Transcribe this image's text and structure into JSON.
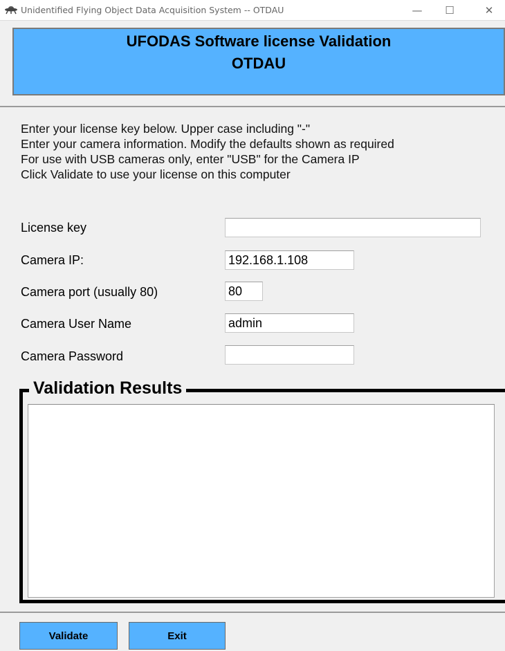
{
  "window": {
    "title": "Unidentified Flying Object Data Acquisition System -- OTDAU",
    "minimize_glyph": "—",
    "maximize_glyph": "☐",
    "close_glyph": "✕",
    "app_icon": "ufo-icon"
  },
  "banner": {
    "line1": "UFODAS Software license Validation",
    "line2": "OTDAU",
    "color": "#55b2ff"
  },
  "instructions": [
    "Enter your license key below.  Upper case including \"-\"",
    "Enter your camera information.  Modify the defaults shown as required",
    "For use with USB cameras only, enter \"USB\" for the Camera IP",
    "Click Validate to use your license on this computer"
  ],
  "form": {
    "license_key": {
      "label": "License key",
      "value": ""
    },
    "camera_ip": {
      "label": "Camera IP:",
      "value": "192.168.1.108"
    },
    "camera_port": {
      "label": "Camera port (usually 80)",
      "value": "80"
    },
    "camera_user": {
      "label": "Camera User Name",
      "value": "admin"
    },
    "camera_password": {
      "label": "Camera Password",
      "value": ""
    }
  },
  "results": {
    "title": "Validation Results",
    "text": ""
  },
  "buttons": {
    "validate": "Validate",
    "exit": "Exit",
    "color": "#55b2ff"
  }
}
